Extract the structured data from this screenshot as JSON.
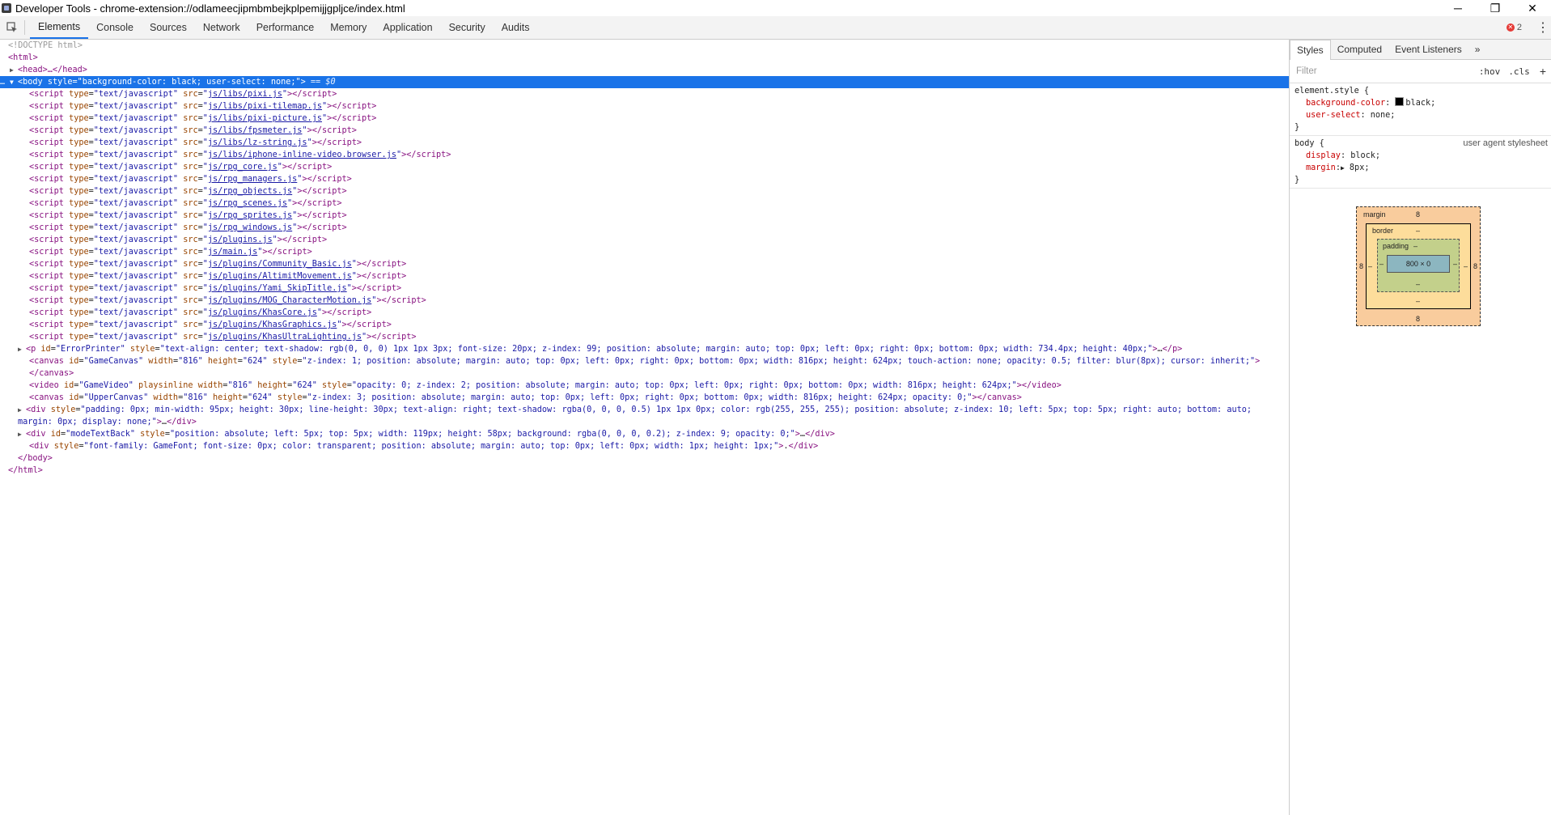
{
  "window": {
    "title": "Developer Tools - chrome-extension://odlameecjipmbmbejkplpemijjgpljce/index.html",
    "minimize": "─",
    "restore": "❐",
    "close": "✕"
  },
  "toolbar": {
    "tabs": [
      "Elements",
      "Console",
      "Sources",
      "Network",
      "Performance",
      "Memory",
      "Application",
      "Security",
      "Audits"
    ],
    "active_tab": "Elements",
    "error_count": "2",
    "error_icon": "✕",
    "menu_glyph": "⋮"
  },
  "dom": {
    "doctype": "<!DOCTYPE html>",
    "html_open": "<html>",
    "head": "<head>…</head>",
    "body_open_tag": "<body",
    "body_style_attr": "style",
    "body_style_val": "\"background-color: black; user-select: none;\"",
    "body_close_angle": ">",
    "body_selected_marker": "== $0",
    "script_type": "text/javascript",
    "scripts": [
      "js/libs/pixi.js",
      "js/libs/pixi-tilemap.js",
      "js/libs/pixi-picture.js",
      "js/libs/fpsmeter.js",
      "js/libs/lz-string.js",
      "js/libs/iphone-inline-video.browser.js",
      "js/rpg_core.js",
      "js/rpg_managers.js",
      "js/rpg_objects.js",
      "js/rpg_scenes.js",
      "js/rpg_sprites.js",
      "js/rpg_windows.js",
      "js/plugins.js",
      "js/main.js",
      "js/plugins/Community_Basic.js",
      "js/plugins/AltimitMovement.js",
      "js/plugins/Yami_SkipTitle.js",
      "js/plugins/MOG_CharacterMotion.js",
      "js/plugins/KhasCore.js",
      "js/plugins/KhasGraphics.js",
      "js/plugins/KhasUltraLighting.js"
    ],
    "p_error_printer": {
      "id": "ErrorPrinter",
      "style": "text-align: center; text-shadow: rgb(0, 0, 0) 1px 1px 3px; font-size: 20px; z-index: 99; position: absolute; margin: auto; top: 0px; left: 0px; right: 0px; bottom: 0px; width: 734.4px; height: 40px;"
    },
    "canvas_game": {
      "id": "GameCanvas",
      "width": "816",
      "height": "624",
      "style": "z-index: 1; position: absolute; margin: auto; top: 0px; left: 0px; right: 0px; bottom: 0px; width: 816px; height: 624px; touch-action: none; opacity: 0.5; filter: blur(8px); cursor: inherit;"
    },
    "video_game": {
      "id": "GameVideo",
      "playsinline": "playsinline",
      "width": "816",
      "height": "624",
      "style": "opacity: 0; z-index: 2; position: absolute; margin: auto; top: 0px; left: 0px; right: 0px; bottom: 0px; width: 816px; height: 624px;"
    },
    "canvas_upper": {
      "id": "UpperCanvas",
      "width": "816",
      "height": "624",
      "style": "z-index: 3; position: absolute; margin: auto; top: 0px; left: 0px; right: 0px; bottom: 0px; width: 816px; height: 624px; opacity: 0;"
    },
    "div_fps": {
      "style": "padding: 0px; min-width: 95px; height: 30px; line-height: 30px; text-align: right; text-shadow: rgba(0, 0, 0, 0.5) 1px 1px 0px; color: rgb(255, 255, 255); position: absolute; z-index: 10; left: 5px; top: 5px; right: auto; bottom: auto; margin: 0px; display: none;"
    },
    "div_mode": {
      "id": "modeTextBack",
      "style": "position: absolute; left: 5px; top: 5px; width: 119px; height: 58px; background: rgba(0, 0, 0, 0.2); z-index: 9; opacity: 0;"
    },
    "div_font": {
      "style": "font-family: GameFont; font-size: 0px; color: transparent; position: absolute; margin: auto; top: 0px; left: 0px; width: 1px; height: 1px;",
      "text": "."
    },
    "body_close": "</body>",
    "html_close": "</html>"
  },
  "sidebar": {
    "tabs": [
      "Styles",
      "Computed",
      "Event Listeners"
    ],
    "more": "»",
    "filter_placeholder": "Filter",
    "hov": ":hov",
    "cls": ".cls",
    "add": "+",
    "element_style": {
      "selector": "element.style {",
      "props": [
        {
          "name": "background-color",
          "value": "black;"
        },
        {
          "name": "user-select",
          "value": "none;"
        }
      ],
      "close": "}"
    },
    "body_rule": {
      "selector": "body {",
      "source": "user agent stylesheet",
      "props": [
        {
          "name": "display",
          "value": "block;"
        },
        {
          "name": "margin",
          "value": "8px;"
        }
      ],
      "close": "}"
    },
    "box_model": {
      "margin_label": "margin",
      "margin_top": "8",
      "margin_bottom": "8",
      "margin_left": "8",
      "margin_right": "8",
      "border_label": "border",
      "border_dash": "–",
      "padding_label": "padding",
      "padding_dash": "–",
      "content": "800 × 0"
    }
  }
}
